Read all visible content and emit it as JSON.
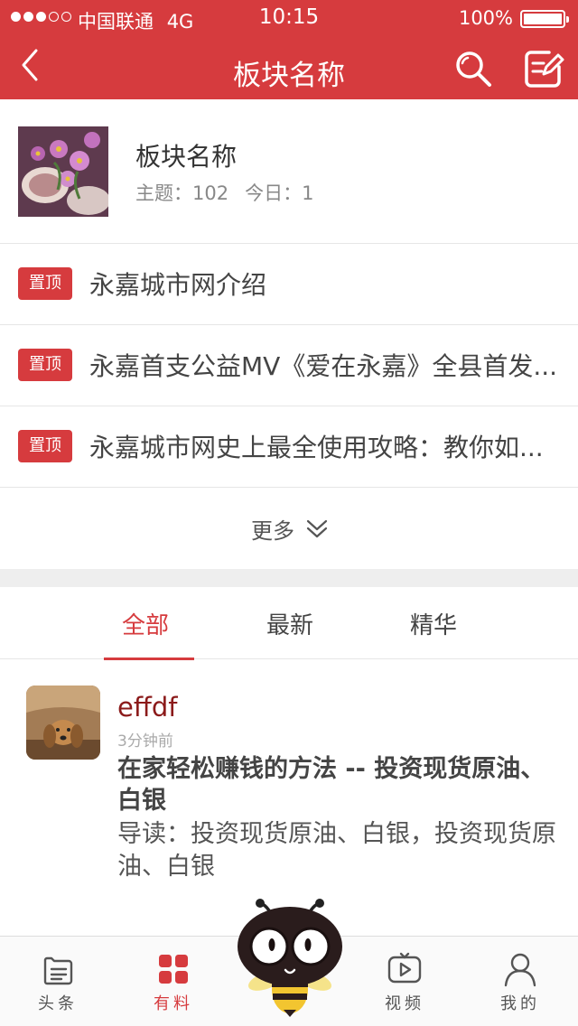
{
  "status_bar": {
    "carrier": "中国联通",
    "network": "4G",
    "time": "10:15",
    "battery": "100%"
  },
  "nav": {
    "title": "板块名称",
    "back_icon": "chevron-left-icon",
    "search_icon": "search-icon",
    "compose_icon": "compose-icon"
  },
  "forum": {
    "name": "板块名称",
    "topics_label": "主题：102",
    "today_label": "今日：1"
  },
  "pinned": {
    "badge": "置顶",
    "items": [
      {
        "title": "永嘉城市网介绍"
      },
      {
        "title": "永嘉首支公益MV《爱在永嘉》全县首发..."
      },
      {
        "title": "永嘉城市网史上最全使用攻略：教你如..."
      }
    ],
    "more_label": "更多"
  },
  "tabs": {
    "items": [
      {
        "label": "全部",
        "active": true
      },
      {
        "label": "最新",
        "active": false
      },
      {
        "label": "精华",
        "active": false
      }
    ]
  },
  "post": {
    "author": "effdf",
    "time": "3分钟前",
    "title": "在家轻松赚钱的方法 -- 投资现货原油、白银",
    "summary": "导读：投资现货原油、白银，投资现货原油、白银"
  },
  "tabbar": {
    "items": [
      {
        "label": "头条",
        "icon": "news-icon",
        "active": false
      },
      {
        "label": "有料",
        "icon": "grid-icon",
        "active": true
      },
      {
        "label": "视频",
        "icon": "video-icon",
        "active": false
      },
      {
        "label": "我的",
        "icon": "profile-icon",
        "active": false
      }
    ]
  },
  "colors": {
    "brand": "#d63b3e",
    "author": "#8b1a1a"
  }
}
